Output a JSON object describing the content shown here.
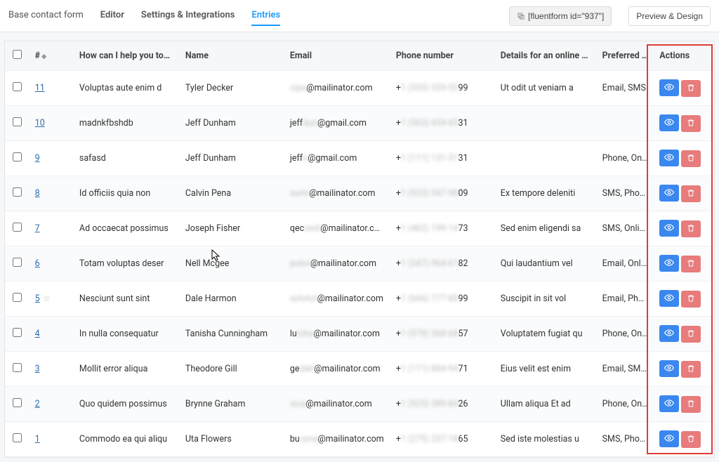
{
  "topbar": {
    "base_label": "Base contact form",
    "editor_label": "Editor",
    "settings_label": "Settings & Integrations",
    "entries_label": "Entries",
    "shortcode_text": "[fluentform id=\"937\"]",
    "preview_label": "Preview & Design"
  },
  "headers": {
    "num": "#",
    "help": "How can I help you today?",
    "name": "Name",
    "email": "Email",
    "phone": "Phone number",
    "details": "Details for an online or vi...",
    "preferred": "Preferred cont",
    "actions": "Actions"
  },
  "rows": [
    {
      "id": "11",
      "starred": false,
      "help": "Voluptas aute enim d",
      "name": "Tyler Decker",
      "email_pre_blur": "cipa",
      "email_post": "@mailinator.com",
      "phone_pre": "+",
      "phone_blur": "1 (555) 555-55",
      "phone_post": "99",
      "details": "Ut odit ut veniam a",
      "pref": "Email, SMS"
    },
    {
      "id": "10",
      "starred": false,
      "help": "madnkfbshdb",
      "name": "Jeff Dunham",
      "email_pre": "jeff",
      "email_blur": "dun",
      "email_post": "@gmail.com",
      "phone_pre": "+",
      "phone_blur": "1 (563) 454-65",
      "phone_post": "31",
      "details": "",
      "pref": ""
    },
    {
      "id": "9",
      "starred": false,
      "help": "safasd",
      "name": "Jeff Dunham",
      "email_pre": "jeff",
      "email_blur": "o",
      "email_post": "@gmail.com",
      "phone_pre": "+",
      "phone_blur": "1 (111) 131-31",
      "phone_post": "31",
      "details": "",
      "pref": "Phone, Online c"
    },
    {
      "id": "8",
      "starred": false,
      "help": "Id officiis quia non",
      "name": "Calvin Pena",
      "email_pre_blur": "sumi",
      "email_post": "@mailinator.com",
      "phone_pre": "+",
      "phone_blur": "1 (923) 347-98",
      "phone_post": "09",
      "details": "Ex tempore deleniti",
      "pref": "SMS, Phone"
    },
    {
      "id": "7",
      "starred": false,
      "help": "Ad occaecat possimus",
      "name": "Joseph Fisher",
      "email_pre": "qec",
      "email_blur": "oxid",
      "email_post": "@mailinator.com",
      "phone_pre": "+",
      "phone_blur": "1 (462) 199-14",
      "phone_post": "73",
      "details": "Sed enim eligendi sa",
      "pref": "SMS, Online ca"
    },
    {
      "id": "6",
      "starred": false,
      "help": "Totam voluptas deser",
      "name": "Nell Mcgee",
      "email_pre_blur": "putut",
      "email_post": "@mailinator.com",
      "phone_pre": "+",
      "phone_blur": "1 (247) 964-61",
      "phone_post": "82",
      "details": "Qui laudantium vel",
      "pref": "Email, Online ca"
    },
    {
      "id": "5",
      "starred": true,
      "help": "Nesciunt sunt sint",
      "name": "Dale Harmon",
      "email_pre_blur": "solotut",
      "email_post": "@mailinator.com",
      "phone_pre": "+",
      "phone_blur": "1 (666) 777-88",
      "phone_post": "99",
      "details": "Suscipit in sit vol",
      "pref": "Email, Phone, O"
    },
    {
      "id": "4",
      "starred": false,
      "help": "In nulla consequatur",
      "name": "Tanisha Cunningham",
      "email_pre": "lu",
      "email_blur": "loha",
      "email_post": "@mailinator.com",
      "phone_pre": "+",
      "phone_blur": "1 (978) 368-68",
      "phone_post": "57",
      "details": "Voluptatem fugiat qu",
      "pref": "Phone, Online c"
    },
    {
      "id": "3",
      "starred": false,
      "help": "Mollit error aliqua",
      "name": "Theodore Gill",
      "email_pre": "ge",
      "email_blur": "dah",
      "email_post": "@mailinator.com",
      "phone_pre": "+",
      "phone_blur": "1 (111) 884-94",
      "phone_post": "71",
      "details": "Eius velit est enim",
      "pref": "Email, SMS, On"
    },
    {
      "id": "2",
      "starred": false,
      "help": "Quo quidem possimus",
      "name": "Brynne Graham",
      "email_pre_blur": "xica",
      "email_post": "@mailinator.com",
      "phone_pre": "+",
      "phone_blur": "1 (925) 389-84",
      "phone_post": "26",
      "details": "Ullam aliqua Et ad",
      "pref": "Phone, Online c"
    },
    {
      "id": "1",
      "starred": false,
      "help": "Commodo ea qui aliqu",
      "name": "Uta Flowers",
      "email_pre": "bu",
      "email_blur": "vyna",
      "email_post": "@mailinator.com",
      "phone_pre": "+",
      "phone_blur": "1 (275) 237-18",
      "phone_post": "65",
      "details": "Sed iste molestias u",
      "pref": "SMS, Phone, O"
    }
  ]
}
